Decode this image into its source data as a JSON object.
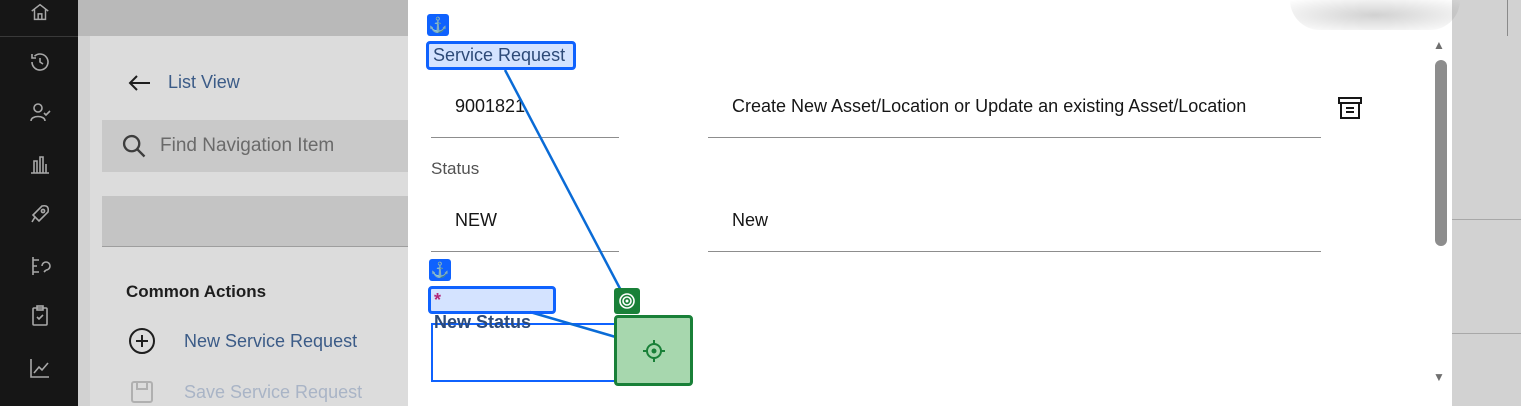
{
  "sidebar": {
    "icons": [
      "home-icon",
      "recent-icon",
      "person-check-icon",
      "bar-chart-icon",
      "rocket-icon",
      "workflow-icon",
      "clipboard-icon",
      "line-chart-icon"
    ]
  },
  "background": {
    "list_view_label": "List View",
    "search_placeholder": "Find Navigation Item",
    "common_actions_heading": "Common Actions",
    "actions": [
      {
        "label": "New Service Request",
        "icon": "add-circle-icon",
        "enabled": true
      },
      {
        "label": "Save Service Request",
        "icon": "save-icon",
        "enabled": false
      }
    ]
  },
  "modal": {
    "service_request": {
      "label": "Service Request",
      "number": "9001821",
      "description": "Create New Asset/Location or Update an existing Asset/Location"
    },
    "status": {
      "label": "Status",
      "code": "NEW",
      "description": "New"
    },
    "new_status": {
      "required_mark": "*",
      "label": "New Status",
      "value": ""
    }
  },
  "colors": {
    "anchor_blue": "#0f62fe",
    "target_green": "#198038",
    "rail_dark": "#161616"
  }
}
